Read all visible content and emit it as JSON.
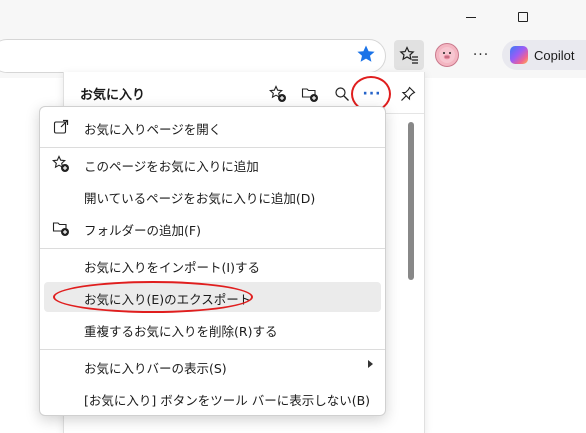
{
  "window": {
    "minimize_icon": "minimize-icon",
    "maximize_icon": "maximize-icon"
  },
  "toolbar": {
    "favorite_star_color": "#1a73e8",
    "more_label": "···",
    "copilot_label": "Copilot"
  },
  "favorites_panel": {
    "title": "お気に入り",
    "more_label": "···",
    "accent_color": "#2563c9"
  },
  "menu": {
    "items": [
      {
        "label": "お気に入りページを開く",
        "icon": "open-external-icon"
      },
      {
        "label": "このページをお気に入りに追加",
        "icon": "star-add-icon"
      },
      {
        "label": "開いているページをお気に入りに追加(D)",
        "icon": ""
      },
      {
        "label": "フォルダーの追加(F)",
        "icon": "folder-add-icon"
      },
      {
        "label": "お気に入りをインポート(I)する",
        "icon": ""
      },
      {
        "label": "お気に入り(E)のエクスポート",
        "icon": ""
      },
      {
        "label": "重複するお気に入りを削除(R)する",
        "icon": ""
      },
      {
        "label": "お気に入りバーの表示(S)",
        "icon": "",
        "submenu": true
      },
      {
        "label": "[お気に入り] ボタンをツール バーに表示しない(B)",
        "icon": ""
      }
    ]
  },
  "annotations": {
    "highlight_color": "#e01e1e"
  }
}
